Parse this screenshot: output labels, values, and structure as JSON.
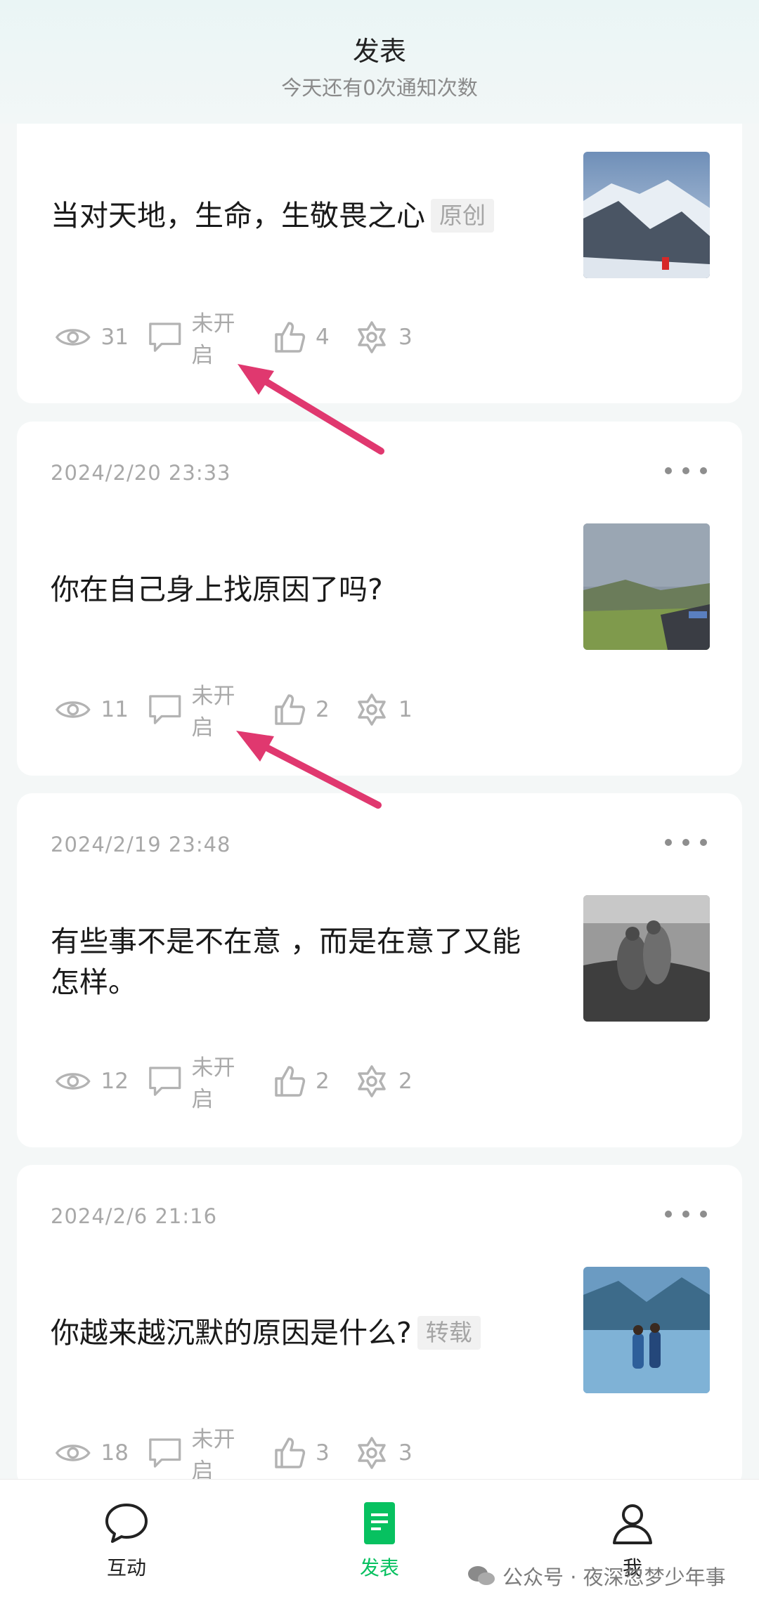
{
  "header": {
    "title": "发表",
    "subtitle": "今天还有0次通知次数"
  },
  "posts": [
    {
      "date": "",
      "text": "当对天地，生命，生敬畏之心",
      "tag": "原创",
      "views": "31",
      "comment_status": "未开启",
      "likes": "4",
      "shares": "3"
    },
    {
      "date": "2024/2/20 23:33",
      "text": "你在自己身上找原因了吗?",
      "tag": "",
      "views": "11",
      "comment_status": "未开启",
      "likes": "2",
      "shares": "1"
    },
    {
      "date": "2024/2/19 23:48",
      "text": "有些事不是不在意 ，而是在意了又能怎样。",
      "tag": "",
      "views": "12",
      "comment_status": "未开启",
      "likes": "2",
      "shares": "2"
    },
    {
      "date": "2024/2/6 21:16",
      "text": "你越来越沉默的原因是什么?",
      "tag": "转载",
      "views": "18",
      "comment_status": "未开启",
      "likes": "3",
      "shares": "3"
    }
  ],
  "tabbar": {
    "items": [
      {
        "label": "互动",
        "icon": "chat-bubble-icon",
        "active": false
      },
      {
        "label": "发表",
        "icon": "document-icon",
        "active": true
      },
      {
        "label": "我",
        "icon": "person-icon",
        "active": false
      }
    ]
  },
  "watermark": {
    "text": "公众号 · 夜深忽梦少年事"
  },
  "colors": {
    "accent": "#07c160",
    "arrow": "#e0386f",
    "muted": "#a9a9a9"
  }
}
